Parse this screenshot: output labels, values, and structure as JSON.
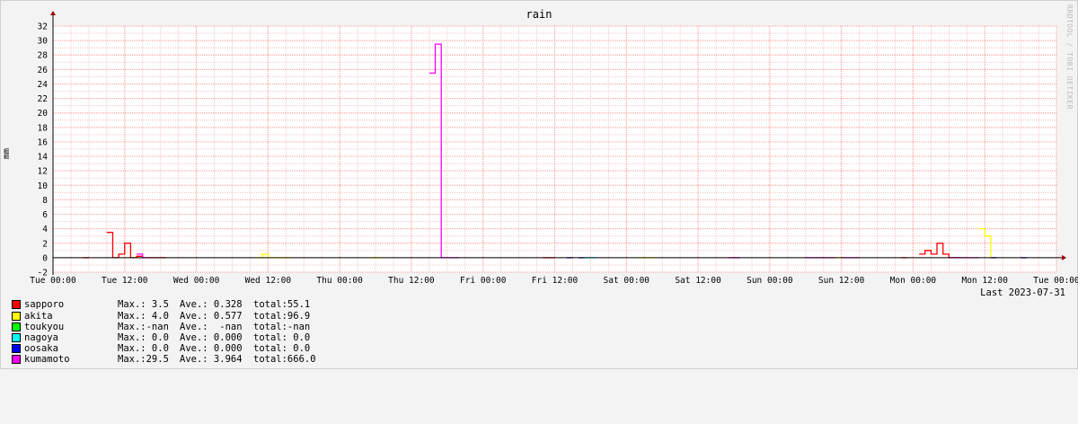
{
  "chart_data": {
    "type": "line",
    "title": "rain",
    "ylabel": "mm",
    "xlabel": "",
    "ylim": [
      -2,
      32
    ],
    "yticks": [
      -2,
      0,
      2,
      4,
      6,
      8,
      10,
      12,
      14,
      16,
      18,
      20,
      22,
      24,
      26,
      28,
      30,
      32
    ],
    "xlim_hours": [
      0,
      168
    ],
    "x_tick_labels": [
      "Tue 00:00",
      "Tue 12:00",
      "Wed 00:00",
      "Wed 12:00",
      "Thu 00:00",
      "Thu 12:00",
      "Fri 00:00",
      "Fri 12:00",
      "Sat 00:00",
      "Sat 12:00",
      "Sun 00:00",
      "Sun 12:00",
      "Mon 00:00",
      "Mon 12:00",
      "Tue 00:00"
    ],
    "grid": true,
    "last_updated": "Last 2023-07-31",
    "watermark": "RRDTOOL / TOBI OETIKER",
    "series": [
      {
        "name": "sapporo",
        "color": "#ff0000",
        "max": "Max.: 3.5",
        "ave": "Ave.: 0.328",
        "total": "total:55.1",
        "points": [
          [
            5,
            0
          ],
          [
            9,
            3.5
          ],
          [
            10,
            0
          ],
          [
            11,
            0.5
          ],
          [
            12,
            2
          ],
          [
            13,
            0
          ],
          [
            14,
            0.2
          ],
          [
            15,
            0
          ],
          [
            16,
            0
          ],
          [
            17,
            0
          ],
          [
            18,
            0
          ],
          [
            82,
            0
          ],
          [
            83,
            0
          ],
          [
            142,
            0
          ],
          [
            145,
            0.5
          ],
          [
            146,
            1
          ],
          [
            147,
            0.5
          ],
          [
            148,
            2
          ],
          [
            149,
            0.5
          ],
          [
            150,
            0
          ],
          [
            151,
            0
          ]
        ]
      },
      {
        "name": "akita",
        "color": "#ffff00",
        "max": "Max.: 4.0",
        "ave": "Ave.: 0.577",
        "total": "total:96.9",
        "points": [
          [
            34,
            0
          ],
          [
            35,
            0.5
          ],
          [
            36,
            0
          ],
          [
            37,
            0
          ],
          [
            38,
            0
          ],
          [
            39,
            0
          ],
          [
            53,
            0
          ],
          [
            54,
            0
          ],
          [
            98,
            0
          ],
          [
            99,
            0
          ],
          [
            100,
            0
          ],
          [
            130,
            0
          ],
          [
            131,
            0
          ],
          [
            155,
            4
          ],
          [
            156,
            3
          ],
          [
            157,
            0
          ]
        ]
      },
      {
        "name": "toukyou",
        "color": "#00ff00",
        "max": "Max.:-nan",
        "ave": "Ave.:  -nan",
        "total": "total:-nan",
        "points": []
      },
      {
        "name": "nagoya",
        "color": "#00ffff",
        "max": "Max.: 0.0",
        "ave": "Ave.: 0.000",
        "total": "total: 0.0",
        "points": [
          [
            89,
            0
          ],
          [
            90,
            0
          ]
        ]
      },
      {
        "name": "oosaka",
        "color": "#0000ff",
        "max": "Max.: 0.0",
        "ave": "Ave.: 0.000",
        "total": "total: 0.0",
        "points": [
          [
            86,
            0
          ],
          [
            88,
            0
          ],
          [
            157,
            0
          ],
          [
            162,
            0
          ]
        ]
      },
      {
        "name": "kumamoto",
        "color": "#ff00ff",
        "max": "Max.:29.5",
        "ave": "Ave.: 3.964",
        "total": "total:666.0",
        "points": [
          [
            14,
            0.5
          ],
          [
            15,
            0
          ],
          [
            63,
            25.5
          ],
          [
            64,
            29.5
          ],
          [
            65,
            0
          ],
          [
            66,
            0
          ],
          [
            67,
            0
          ],
          [
            113,
            0
          ],
          [
            114,
            0
          ],
          [
            126,
            0
          ],
          [
            127,
            0
          ],
          [
            128,
            0
          ],
          [
            129,
            0
          ],
          [
            130,
            0
          ],
          [
            132,
            0
          ],
          [
            133,
            0
          ],
          [
            134,
            0
          ],
          [
            150,
            0
          ],
          [
            151,
            0
          ],
          [
            152,
            0
          ],
          [
            153,
            0
          ],
          [
            154,
            0
          ]
        ]
      }
    ]
  }
}
